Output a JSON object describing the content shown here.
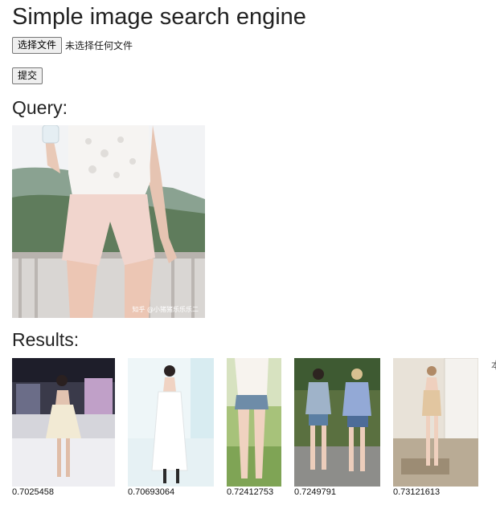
{
  "header": {
    "title": "Simple image search engine"
  },
  "upload_form": {
    "choose_file_label": "选择文件",
    "no_file_text": "未选择任何文件",
    "submit_label": "提交"
  },
  "query": {
    "heading": "Query:",
    "image_alt": "query-dress-photo",
    "watermark": "知乎 @小猪猪乐乐乐二",
    "colors": {
      "top": "#eef0f2",
      "hill": "#6e8a6a",
      "skin": "#e8c8b6",
      "shorts": "#f2d7d0",
      "rail": "#c9c6c4"
    }
  },
  "results": {
    "heading": "Results:",
    "items": [
      {
        "score": "0.7025458",
        "image_alt": "result-1-white-dress-mall"
      },
      {
        "score": "0.70693064",
        "image_alt": "result-2-white-dress-stage"
      },
      {
        "score": "0.72412753",
        "image_alt": "result-3-denim-shorts-grass"
      },
      {
        "score": "0.7249791",
        "image_alt": "result-4-two-women-street"
      },
      {
        "score": "0.73121613",
        "image_alt": "result-5-sequin-dress-interior"
      }
    ],
    "overflow_glyph": "本"
  }
}
